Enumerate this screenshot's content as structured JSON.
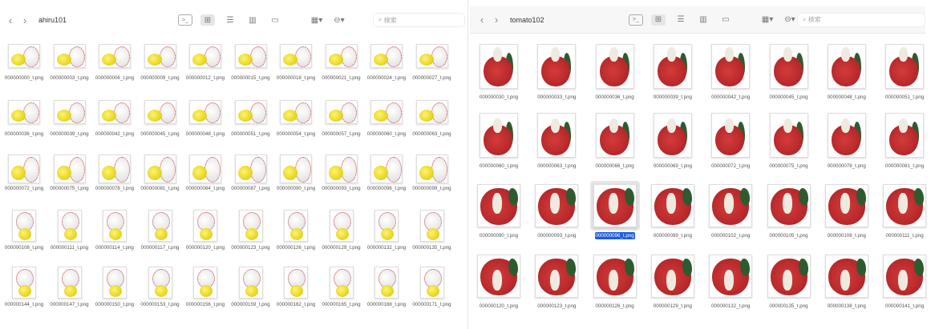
{
  "left_window": {
    "title": "ahiru101",
    "search_placeholder": "検索",
    "files": [
      "000000000_t.png",
      "000000003_t.png",
      "000000006_t.png",
      "000000009_t.png",
      "000000012_t.png",
      "000000015_t.png",
      "000000018_t.png",
      "000000021_t.png",
      "000000024_t.png",
      "000000027_t.png",
      "000000036_t.png",
      "000000039_t.png",
      "000000042_t.png",
      "000000045_t.png",
      "000000048_t.png",
      "000000051_t.png",
      "000000054_t.png",
      "000000057_t.png",
      "000000060_t.png",
      "000000063_t.png",
      "000000072_t.png",
      "000000075_t.png",
      "000000078_t.png",
      "000000081_t.png",
      "000000084_t.png",
      "000000087_t.png",
      "000000090_t.png",
      "000000093_t.png",
      "000000096_t.png",
      "000000099_t.png",
      "000000108_t.png",
      "000000111_t.png",
      "000000114_t.png",
      "000000117_t.png",
      "000000120_t.png",
      "000000123_t.png",
      "000000126_t.png",
      "000000129_t.png",
      "000000132_t.png",
      "000000135_t.png",
      "000000144_t.png",
      "000000147_t.png",
      "000000150_t.png",
      "000000153_t.png",
      "000000156_t.png",
      "000000159_t.png",
      "000000162_t.png",
      "000000165_t.png",
      "000000168_t.png",
      "000000171_t.png"
    ]
  },
  "right_window": {
    "title": "tomato102",
    "search_placeholder": "検索",
    "selected_file": "000000096_t.png",
    "files": [
      "000000030_t.png",
      "000000033_t.png",
      "000000036_t.png",
      "000000039_t.png",
      "000000042_t.png",
      "000000045_t.png",
      "000000048_t.png",
      "000000051_t.png",
      "000000060_t.png",
      "000000063_t.png",
      "000000066_t.png",
      "000000069_t.png",
      "000000072_t.png",
      "000000075_t.png",
      "000000078_t.png",
      "000000081_t.png",
      "000000090_t.png",
      "000000093_t.png",
      "000000096_t.png",
      "000000099_t.png",
      "000000102_t.png",
      "000000105_t.png",
      "000000108_t.png",
      "000000111_t.png",
      "000000120_t.png",
      "000000123_t.png",
      "000000126_t.png",
      "000000129_t.png",
      "000000132_t.png",
      "000000135_t.png",
      "000000138_t.png",
      "000000141_t.png"
    ]
  },
  "toolbar_icons": [
    "back-icon",
    "forward-icon",
    "terminal-icon",
    "icon-view-icon",
    "list-view-icon",
    "column-view-icon",
    "gallery-view-icon",
    "group-icon",
    "action-icon",
    "share-icon",
    "tag-icon",
    "search-icon"
  ],
  "colors": {
    "selection": "#1f5ae0"
  }
}
